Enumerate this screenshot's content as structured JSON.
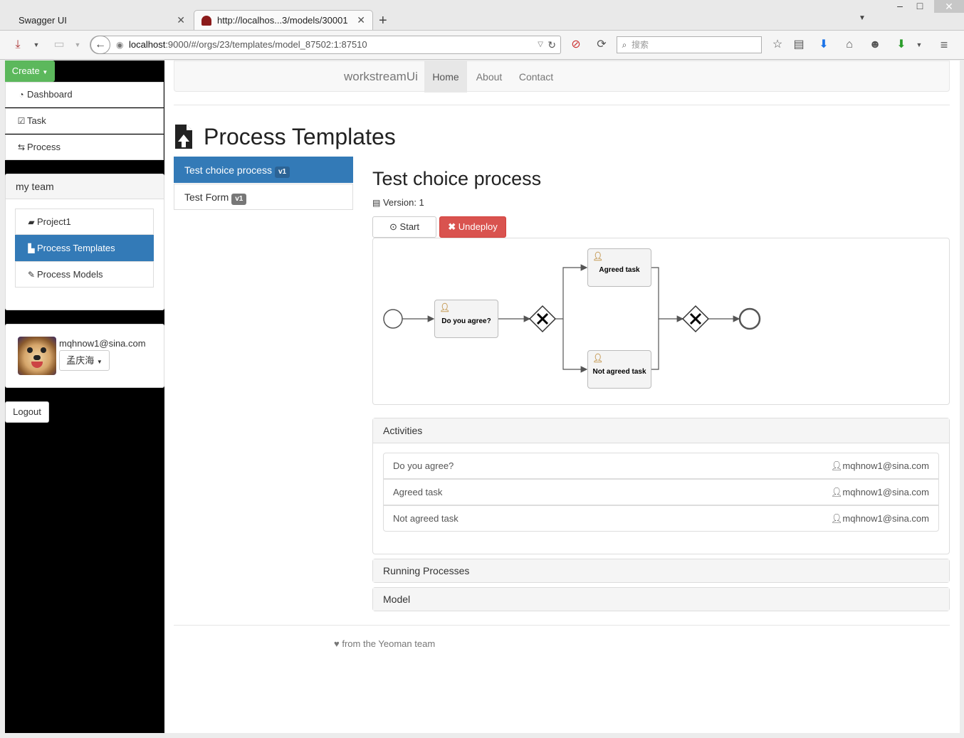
{
  "browser": {
    "tabs": [
      {
        "label": "Swagger UI",
        "active": false
      },
      {
        "label": "http://localhos...3/models/30001",
        "active": true
      }
    ],
    "new_tab_label": "+",
    "url_host": "localhost",
    "url_rest": ":9000/#/orgs/23/templates/model_87502:1:87510",
    "search_placeholder": "搜索"
  },
  "sidebar": {
    "create_label": "Create",
    "nav": [
      {
        "label": "Dashboard",
        "icon": "dashboard-icon"
      },
      {
        "label": "Task",
        "icon": "check-square-icon"
      },
      {
        "label": "Process",
        "icon": "retweet-icon"
      }
    ],
    "team_title": "my team",
    "team_items": [
      {
        "label": "Project1",
        "icon": "briefcase-icon"
      },
      {
        "label": "Process Templates",
        "icon": "file-icon",
        "active": true
      },
      {
        "label": "Process Models",
        "icon": "pencil-icon"
      }
    ],
    "user_email": "mqhnow1@sina.com",
    "user_name": "孟庆海",
    "logout_label": "Logout"
  },
  "topnav": {
    "brand": "workstreamUi",
    "items": [
      {
        "label": "Home",
        "active": true
      },
      {
        "label": "About"
      },
      {
        "label": "Contact"
      }
    ]
  },
  "page_title": "Process Templates",
  "templates": [
    {
      "label": "Test choice process",
      "version": "v1",
      "active": true
    },
    {
      "label": "Test Form",
      "version": "v1"
    }
  ],
  "detail": {
    "title": "Test choice process",
    "version_label": "Version: 1",
    "start_label": "Start",
    "undeploy_label": "Undeploy",
    "diagram": {
      "tasks": [
        "Do you agree?",
        "Agreed task",
        "Not agreed task"
      ]
    },
    "activities_title": "Activities",
    "activities": [
      {
        "name": "Do you agree?",
        "assignee": "mqhnow1@sina.com"
      },
      {
        "name": "Agreed task",
        "assignee": "mqhnow1@sina.com"
      },
      {
        "name": "Not agreed task",
        "assignee": "mqhnow1@sina.com"
      }
    ],
    "running_title": "Running Processes",
    "model_title": "Model"
  },
  "footer": "from the Yeoman team",
  "colors": {
    "primary": "#337ab7",
    "success": "#5cb85c",
    "danger": "#d9534f"
  }
}
